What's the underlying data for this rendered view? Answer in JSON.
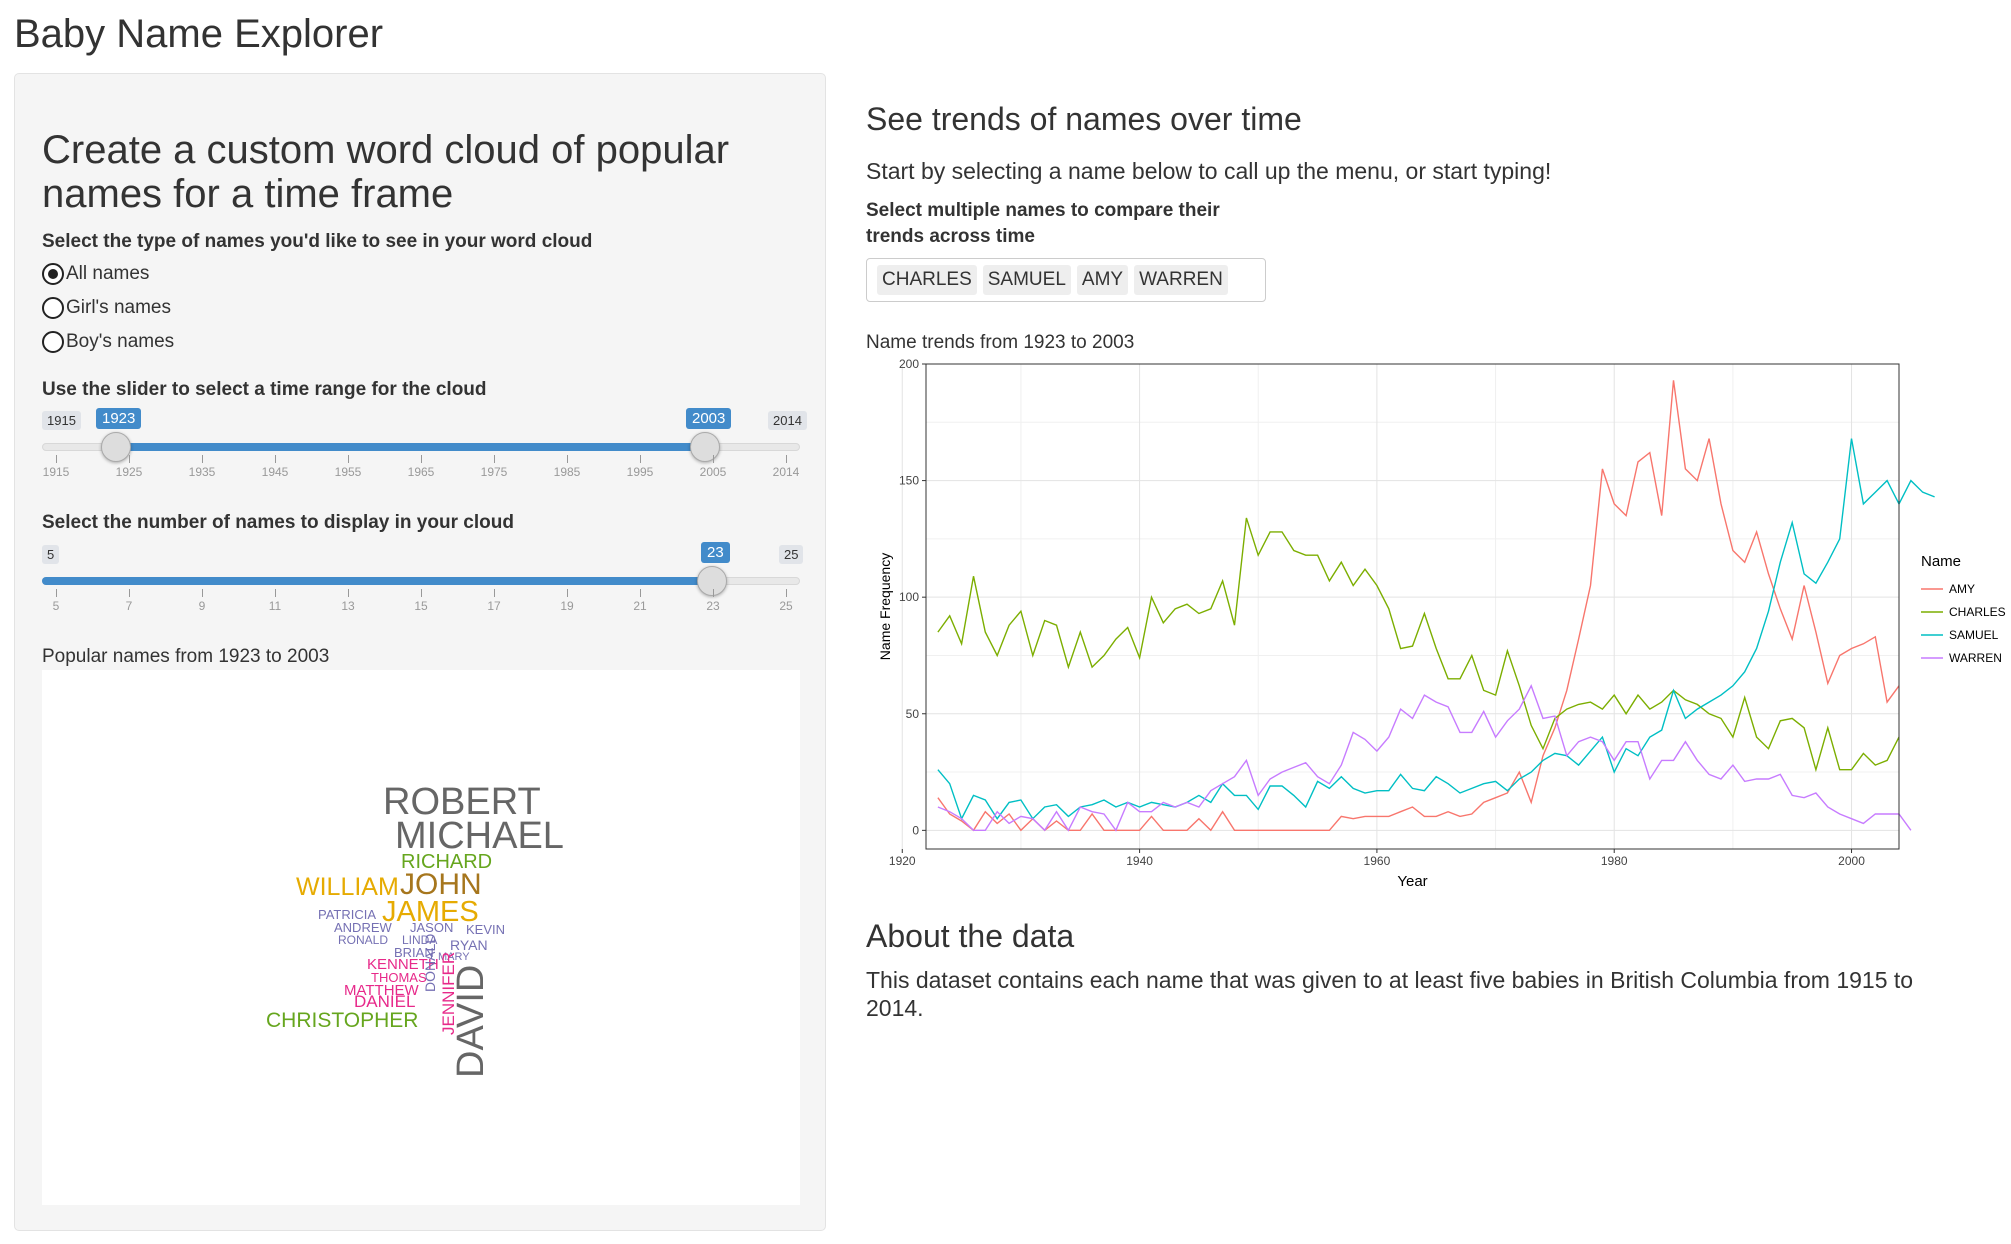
{
  "app": {
    "title": "Baby Name Explorer"
  },
  "left": {
    "heading": "Create a custom word cloud of popular names for a time frame",
    "type_label": "Select the type of names you'd like to see in your word cloud",
    "radio_options": [
      {
        "label": "All names",
        "selected": true
      },
      {
        "label": "Girl's names",
        "selected": false
      },
      {
        "label": "Boy's names",
        "selected": false
      }
    ],
    "year_slider": {
      "label": "Use the slider to select a time range for the cloud",
      "min": 1915,
      "max": 2014,
      "from": 1923,
      "to": 2003,
      "min_label": "1915",
      "max_label": "2014",
      "from_label": "1923",
      "to_label": "2003",
      "ticks": [
        "1915",
        "1925",
        "1935",
        "1945",
        "1955",
        "1965",
        "1975",
        "1985",
        "1995",
        "2005",
        "2014"
      ]
    },
    "count_slider": {
      "label": "Select the number of names to display in your cloud",
      "min": 5,
      "max": 25,
      "value": 23,
      "min_label": "5",
      "max_label": "25",
      "value_label": "23",
      "ticks": [
        "5",
        "7",
        "9",
        "11",
        "13",
        "15",
        "17",
        "19",
        "21",
        "23",
        "25"
      ]
    },
    "cloud_caption": "Popular names from 1923 to 2003",
    "cloud_words": [
      {
        "text": "ROBERT",
        "color": "#666666"
      },
      {
        "text": "MICHAEL",
        "color": "#666666"
      },
      {
        "text": "RICHARD",
        "color": "#66a61e"
      },
      {
        "text": "WILLIAM",
        "color": "#e6ab02"
      },
      {
        "text": "JOHN",
        "color": "#a6761d"
      },
      {
        "text": "JAMES",
        "color": "#e6ab02"
      },
      {
        "text": "PATRICIA",
        "color": "#7570b3"
      },
      {
        "text": "ANDREW",
        "color": "#7570b3"
      },
      {
        "text": "JASON",
        "color": "#7570b3"
      },
      {
        "text": "KEVIN",
        "color": "#7570b3"
      },
      {
        "text": "RONALD",
        "color": "#7570b3"
      },
      {
        "text": "LINDA",
        "color": "#7570b3"
      },
      {
        "text": "BRIAN",
        "color": "#7570b3"
      },
      {
        "text": "RYAN",
        "color": "#7570b3"
      },
      {
        "text": "MARY",
        "color": "#7570b3"
      },
      {
        "text": "KENNETH",
        "color": "#e7298a"
      },
      {
        "text": "THOMAS",
        "color": "#e7298a"
      },
      {
        "text": "MATTHEW",
        "color": "#e7298a"
      },
      {
        "text": "DANIEL",
        "color": "#e7298a"
      },
      {
        "text": "CHRISTOPHER",
        "color": "#66a61e"
      },
      {
        "text": "DONALD",
        "color": "#7570b3"
      },
      {
        "text": "JENNIFER",
        "color": "#e7298a"
      },
      {
        "text": "DAVID",
        "color": "#666666"
      }
    ]
  },
  "right": {
    "heading": "See trends of names over time",
    "intro": "Start by selecting a name below to call up the menu, or start typing!",
    "select_label": "Select multiple names to compare their trends across time",
    "selected_names": [
      "CHARLES",
      "SAMUEL",
      "AMY",
      "WARREN"
    ],
    "chart_caption": "Name trends from 1923 to 2003",
    "about_heading": "About the data",
    "about_text": "This dataset contains each name that was given to at least five babies in British Columbia from 1915 to 2014."
  },
  "chart_data": {
    "type": "line",
    "title": "",
    "xlabel": "Year",
    "ylabel": "Name Frequency",
    "xlim": [
      1922,
      2004
    ],
    "ylim": [
      -8,
      200
    ],
    "xticks": [
      1920,
      1940,
      1960,
      1980,
      2000
    ],
    "yticks": [
      0,
      50,
      100,
      150,
      200
    ],
    "legend_title": "Name",
    "legend_position": "right",
    "grid": true,
    "x_start": 1923,
    "series": [
      {
        "name": "AMY",
        "color": "#F8766D",
        "values": [
          14,
          7,
          4,
          0,
          8,
          3,
          7,
          0,
          5,
          0,
          4,
          0,
          0,
          7,
          0,
          0,
          0,
          0,
          6,
          0,
          0,
          0,
          5,
          0,
          8,
          0,
          0,
          0,
          0,
          0,
          0,
          0,
          0,
          0,
          6,
          5,
          6,
          6,
          6,
          8,
          10,
          6,
          6,
          8,
          6,
          7,
          12,
          14,
          16,
          25,
          12,
          32,
          44,
          60,
          82,
          105,
          155,
          140,
          135,
          158,
          162,
          135,
          193,
          155,
          150,
          168,
          140,
          120,
          115,
          128,
          110,
          95,
          82,
          105,
          85,
          63,
          75,
          78,
          80,
          83,
          55,
          62,
          null
        ]
      },
      {
        "name": "CHARLES",
        "color": "#7CAE00",
        "values": [
          85,
          92,
          80,
          109,
          85,
          75,
          88,
          94,
          75,
          90,
          88,
          70,
          85,
          70,
          75,
          82,
          87,
          74,
          100,
          89,
          95,
          97,
          93,
          95,
          107,
          88,
          134,
          118,
          128,
          128,
          120,
          118,
          118,
          107,
          115,
          105,
          112,
          105,
          95,
          78,
          79,
          93,
          78,
          65,
          65,
          75,
          60,
          58,
          77,
          62,
          45,
          35,
          48,
          52,
          54,
          55,
          52,
          58,
          50,
          58,
          52,
          55,
          60,
          56,
          54,
          50,
          48,
          40,
          57,
          40,
          35,
          47,
          48,
          44,
          26,
          44,
          26,
          26,
          33,
          28,
          30,
          40,
          null
        ]
      },
      {
        "name": "SAMUEL",
        "color": "#00BFC4",
        "values": [
          26,
          20,
          5,
          15,
          13,
          5,
          12,
          13,
          5,
          10,
          11,
          6,
          10,
          11,
          13,
          10,
          12,
          10,
          12,
          11,
          10,
          12,
          15,
          12,
          20,
          15,
          15,
          9,
          19,
          19,
          15,
          10,
          21,
          18,
          23,
          18,
          16,
          17,
          17,
          24,
          18,
          17,
          23,
          20,
          16,
          18,
          20,
          21,
          17,
          22,
          25,
          30,
          33,
          32,
          28,
          34,
          40,
          25,
          35,
          32,
          40,
          43,
          60,
          48,
          52,
          55,
          58,
          62,
          68,
          78,
          94,
          115,
          132,
          110,
          106,
          115,
          125,
          168,
          140,
          145,
          150,
          140,
          150,
          145,
          143,
          null
        ]
      },
      {
        "name": "WARREN",
        "color": "#C77CFF",
        "values": [
          10,
          8,
          5,
          0,
          0,
          8,
          3,
          6,
          5,
          0,
          8,
          0,
          10,
          8,
          7,
          0,
          12,
          8,
          8,
          12,
          10,
          12,
          10,
          17,
          20,
          23,
          30,
          15,
          22,
          25,
          27,
          29,
          23,
          20,
          28,
          42,
          39,
          34,
          40,
          52,
          48,
          58,
          55,
          53,
          42,
          42,
          51,
          40,
          47,
          52,
          62,
          48,
          49,
          32,
          38,
          40,
          38,
          30,
          38,
          38,
          22,
          30,
          30,
          38,
          30,
          24,
          22,
          28,
          21,
          22,
          22,
          24,
          15,
          14,
          16,
          10,
          7,
          5,
          3,
          7,
          7,
          7,
          0,
          null
        ]
      }
    ]
  }
}
